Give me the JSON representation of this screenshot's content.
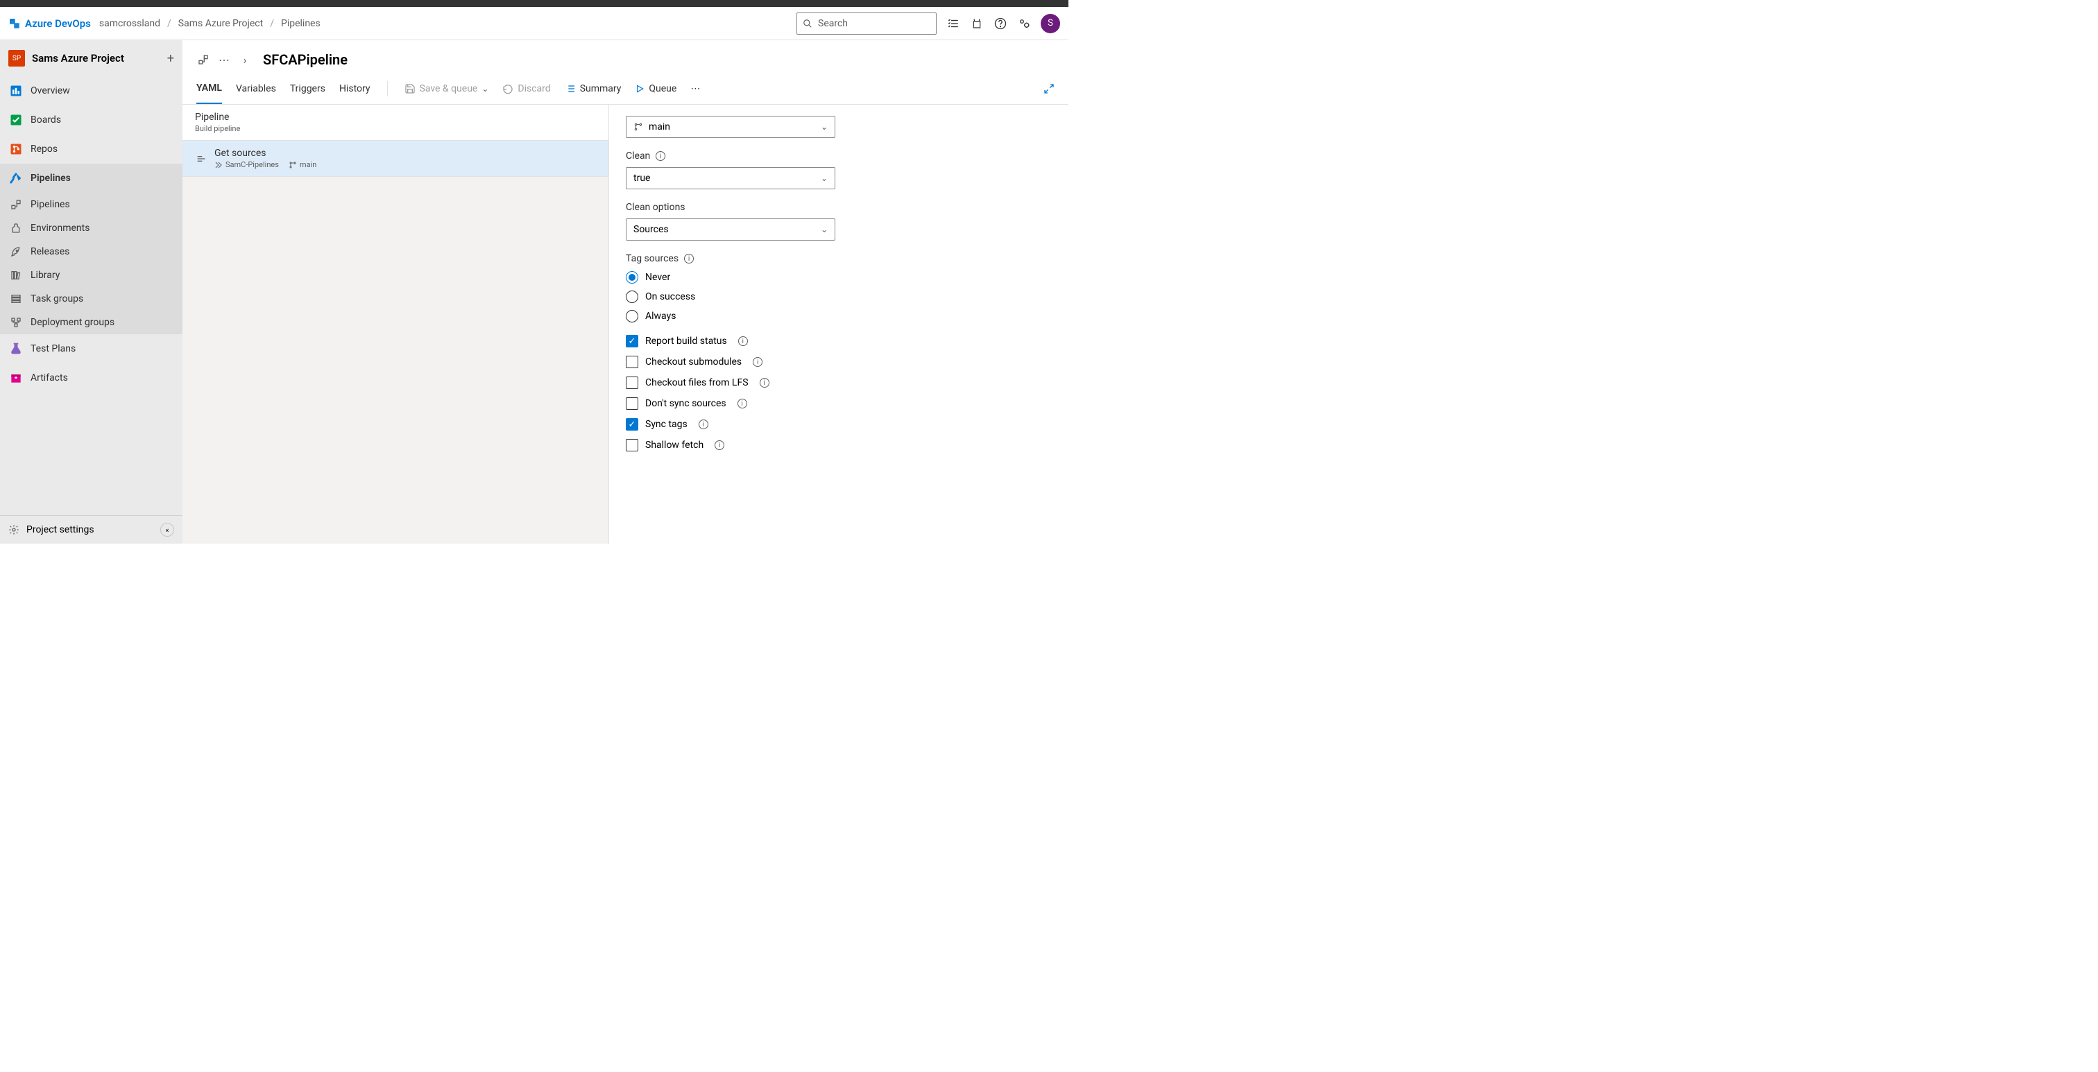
{
  "header": {
    "product": "Azure DevOps",
    "breadcrumb": [
      "samcrossland",
      "Sams Azure Project",
      "Pipelines"
    ],
    "search_placeholder": "Search",
    "avatar_initial": "S"
  },
  "sidebar": {
    "project_initials": "SP",
    "project_name": "Sams Azure Project",
    "items": [
      {
        "label": "Overview"
      },
      {
        "label": "Boards"
      },
      {
        "label": "Repos"
      },
      {
        "label": "Pipelines"
      },
      {
        "label": "Test Plans"
      },
      {
        "label": "Artifacts"
      }
    ],
    "sub_items": [
      {
        "label": "Pipelines"
      },
      {
        "label": "Environments"
      },
      {
        "label": "Releases"
      },
      {
        "label": "Library"
      },
      {
        "label": "Task groups"
      },
      {
        "label": "Deployment groups"
      }
    ],
    "footer": "Project settings"
  },
  "page": {
    "title": "SFCAPipeline",
    "tabs": [
      "YAML",
      "Variables",
      "Triggers",
      "History"
    ],
    "actions": {
      "save_queue": "Save & queue",
      "discard": "Discard",
      "summary": "Summary",
      "queue": "Queue"
    }
  },
  "steps": {
    "pipeline": {
      "title": "Pipeline",
      "sub": "Build pipeline"
    },
    "get_sources": {
      "title": "Get sources",
      "repo": "SamC-Pipelines",
      "branch": "main"
    }
  },
  "form": {
    "branch": "main",
    "clean_label": "Clean",
    "clean_value": "true",
    "clean_options_label": "Clean options",
    "clean_options_value": "Sources",
    "tag_sources_label": "Tag sources",
    "tag_options": [
      "Never",
      "On success",
      "Always"
    ],
    "checks": [
      {
        "label": "Report build status",
        "checked": true,
        "info": true
      },
      {
        "label": "Checkout submodules",
        "checked": false,
        "info": true
      },
      {
        "label": "Checkout files from LFS",
        "checked": false,
        "info": true
      },
      {
        "label": "Don't sync sources",
        "checked": false,
        "info": true
      },
      {
        "label": "Sync tags",
        "checked": true,
        "info": true
      },
      {
        "label": "Shallow fetch",
        "checked": false,
        "info": true
      }
    ]
  }
}
